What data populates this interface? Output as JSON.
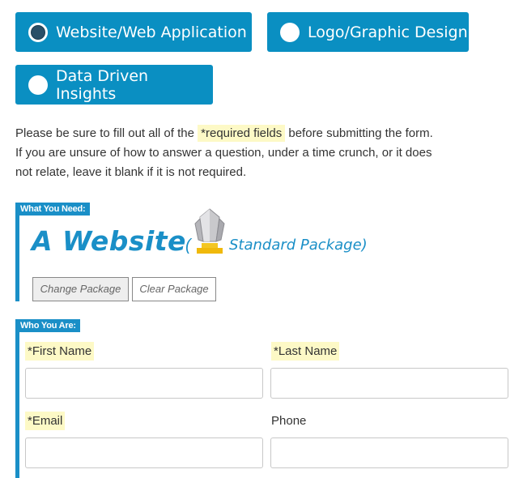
{
  "project_options": [
    {
      "label": "Website/Web Application",
      "selected": true
    },
    {
      "label": "Logo/Graphic Design",
      "selected": false
    },
    {
      "label": "Data Driven Insights",
      "selected": false
    }
  ],
  "instructions": {
    "line1_pre": "Please be sure to fill out all of the ",
    "required_note": "*required fields",
    "line1_post": " before submitting the form.",
    "line2": "If you are unsure of how to answer a question, under a time crunch, or it does",
    "line3": "not relate, leave it blank if it is not required."
  },
  "need_section": {
    "tag": "What You Need:",
    "title": "A Website",
    "paren_open": "(",
    "package": "Standard Package)",
    "change_button": "Change Package",
    "clear_button": "Clear Package"
  },
  "who_section": {
    "tag": "Who You Are:",
    "first_name_label": "*First Name",
    "last_name_label": "*Last Name",
    "email_label": "*Email",
    "phone_label": "Phone",
    "first_name_value": "",
    "last_name_value": "",
    "email_value": "",
    "phone_value": ""
  },
  "colors": {
    "brand": "#0a8fc2",
    "highlight": "#fdf9c6"
  }
}
